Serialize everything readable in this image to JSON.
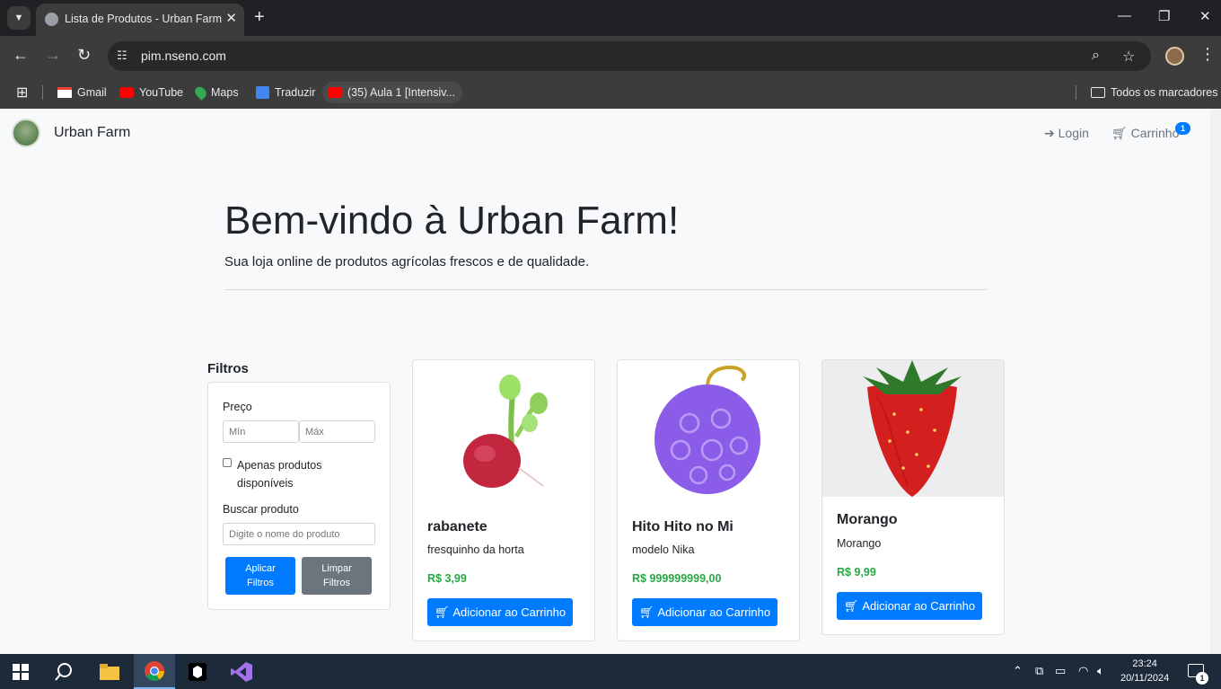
{
  "browser": {
    "tab_title": "Lista de Produtos - Urban Farm",
    "url": "pim.nseno.com",
    "bookmarks": [
      {
        "label": "Gmail",
        "icon": "gmail-icon"
      },
      {
        "label": "YouTube",
        "icon": "youtube-icon"
      },
      {
        "label": "Maps",
        "icon": "maps-icon"
      },
      {
        "label": "Traduzir",
        "icon": "translate-icon"
      },
      {
        "label": "(35) Aula 1 [Intensiv...",
        "icon": "youtube-icon"
      }
    ],
    "all_bookmarks": "Todos os marcadores"
  },
  "navbar": {
    "brand": "Urban Farm",
    "login": "Login",
    "cart": "Carrinho",
    "cart_count": "1"
  },
  "hero": {
    "title": "Bem-vindo à Urban Farm!",
    "subtitle": "Sua loja online de produtos agrícolas frescos e de qualidade."
  },
  "filters": {
    "heading": "Filtros",
    "price_label": "Preço",
    "min_placeholder": "Mín",
    "max_placeholder": "Máx",
    "available_line1": "Apenas produtos",
    "available_line2": "disponíveis",
    "search_label": "Buscar produto",
    "search_placeholder": "Digite o nome do produto",
    "apply_line1": "Aplicar",
    "apply_line2": "Filtros",
    "clear_line1": "Limpar",
    "clear_line2": "Filtros"
  },
  "products": [
    {
      "name": "rabanete",
      "description": "fresquinho da horta",
      "price": "R$ 3,99",
      "button": "Adicionar ao Carrinho"
    },
    {
      "name": "Hito Hito no Mi",
      "description": "modelo Nika",
      "price": "R$ 999999999,00",
      "button": "Adicionar ao Carrinho"
    },
    {
      "name": "Morango",
      "description": "Morango",
      "price": "R$ 9,99",
      "button": "Adicionar ao Carrinho"
    }
  ],
  "taskbar": {
    "time": "23:24",
    "date": "20/11/2024",
    "notifications": "1"
  },
  "colors": {
    "primary": "#007bff",
    "secondary": "#6c757d",
    "price": "#28a745"
  }
}
